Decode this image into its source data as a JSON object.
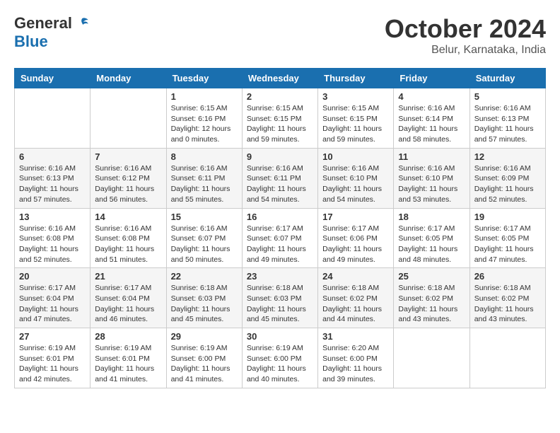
{
  "logo": {
    "general": "General",
    "blue": "Blue"
  },
  "title": {
    "month": "October 2024",
    "location": "Belur, Karnataka, India"
  },
  "days_of_week": [
    "Sunday",
    "Monday",
    "Tuesday",
    "Wednesday",
    "Thursday",
    "Friday",
    "Saturday"
  ],
  "weeks": [
    [
      {
        "day": "",
        "info": ""
      },
      {
        "day": "",
        "info": ""
      },
      {
        "day": "1",
        "info": "Sunrise: 6:15 AM\nSunset: 6:16 PM\nDaylight: 12 hours and 0 minutes."
      },
      {
        "day": "2",
        "info": "Sunrise: 6:15 AM\nSunset: 6:15 PM\nDaylight: 11 hours and 59 minutes."
      },
      {
        "day": "3",
        "info": "Sunrise: 6:15 AM\nSunset: 6:15 PM\nDaylight: 11 hours and 59 minutes."
      },
      {
        "day": "4",
        "info": "Sunrise: 6:16 AM\nSunset: 6:14 PM\nDaylight: 11 hours and 58 minutes."
      },
      {
        "day": "5",
        "info": "Sunrise: 6:16 AM\nSunset: 6:13 PM\nDaylight: 11 hours and 57 minutes."
      }
    ],
    [
      {
        "day": "6",
        "info": "Sunrise: 6:16 AM\nSunset: 6:13 PM\nDaylight: 11 hours and 57 minutes."
      },
      {
        "day": "7",
        "info": "Sunrise: 6:16 AM\nSunset: 6:12 PM\nDaylight: 11 hours and 56 minutes."
      },
      {
        "day": "8",
        "info": "Sunrise: 6:16 AM\nSunset: 6:11 PM\nDaylight: 11 hours and 55 minutes."
      },
      {
        "day": "9",
        "info": "Sunrise: 6:16 AM\nSunset: 6:11 PM\nDaylight: 11 hours and 54 minutes."
      },
      {
        "day": "10",
        "info": "Sunrise: 6:16 AM\nSunset: 6:10 PM\nDaylight: 11 hours and 54 minutes."
      },
      {
        "day": "11",
        "info": "Sunrise: 6:16 AM\nSunset: 6:10 PM\nDaylight: 11 hours and 53 minutes."
      },
      {
        "day": "12",
        "info": "Sunrise: 6:16 AM\nSunset: 6:09 PM\nDaylight: 11 hours and 52 minutes."
      }
    ],
    [
      {
        "day": "13",
        "info": "Sunrise: 6:16 AM\nSunset: 6:08 PM\nDaylight: 11 hours and 52 minutes."
      },
      {
        "day": "14",
        "info": "Sunrise: 6:16 AM\nSunset: 6:08 PM\nDaylight: 11 hours and 51 minutes."
      },
      {
        "day": "15",
        "info": "Sunrise: 6:16 AM\nSunset: 6:07 PM\nDaylight: 11 hours and 50 minutes."
      },
      {
        "day": "16",
        "info": "Sunrise: 6:17 AM\nSunset: 6:07 PM\nDaylight: 11 hours and 49 minutes."
      },
      {
        "day": "17",
        "info": "Sunrise: 6:17 AM\nSunset: 6:06 PM\nDaylight: 11 hours and 49 minutes."
      },
      {
        "day": "18",
        "info": "Sunrise: 6:17 AM\nSunset: 6:05 PM\nDaylight: 11 hours and 48 minutes."
      },
      {
        "day": "19",
        "info": "Sunrise: 6:17 AM\nSunset: 6:05 PM\nDaylight: 11 hours and 47 minutes."
      }
    ],
    [
      {
        "day": "20",
        "info": "Sunrise: 6:17 AM\nSunset: 6:04 PM\nDaylight: 11 hours and 47 minutes."
      },
      {
        "day": "21",
        "info": "Sunrise: 6:17 AM\nSunset: 6:04 PM\nDaylight: 11 hours and 46 minutes."
      },
      {
        "day": "22",
        "info": "Sunrise: 6:18 AM\nSunset: 6:03 PM\nDaylight: 11 hours and 45 minutes."
      },
      {
        "day": "23",
        "info": "Sunrise: 6:18 AM\nSunset: 6:03 PM\nDaylight: 11 hours and 45 minutes."
      },
      {
        "day": "24",
        "info": "Sunrise: 6:18 AM\nSunset: 6:02 PM\nDaylight: 11 hours and 44 minutes."
      },
      {
        "day": "25",
        "info": "Sunrise: 6:18 AM\nSunset: 6:02 PM\nDaylight: 11 hours and 43 minutes."
      },
      {
        "day": "26",
        "info": "Sunrise: 6:18 AM\nSunset: 6:02 PM\nDaylight: 11 hours and 43 minutes."
      }
    ],
    [
      {
        "day": "27",
        "info": "Sunrise: 6:19 AM\nSunset: 6:01 PM\nDaylight: 11 hours and 42 minutes."
      },
      {
        "day": "28",
        "info": "Sunrise: 6:19 AM\nSunset: 6:01 PM\nDaylight: 11 hours and 41 minutes."
      },
      {
        "day": "29",
        "info": "Sunrise: 6:19 AM\nSunset: 6:00 PM\nDaylight: 11 hours and 41 minutes."
      },
      {
        "day": "30",
        "info": "Sunrise: 6:19 AM\nSunset: 6:00 PM\nDaylight: 11 hours and 40 minutes."
      },
      {
        "day": "31",
        "info": "Sunrise: 6:20 AM\nSunset: 6:00 PM\nDaylight: 11 hours and 39 minutes."
      },
      {
        "day": "",
        "info": ""
      },
      {
        "day": "",
        "info": ""
      }
    ]
  ]
}
